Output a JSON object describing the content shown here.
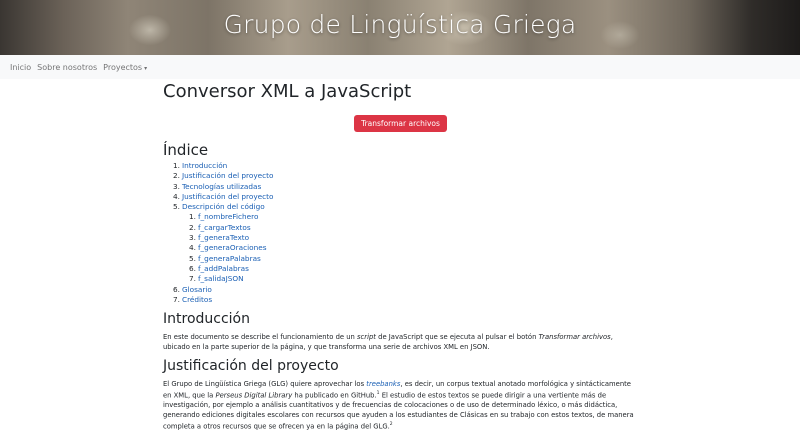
{
  "header": {
    "title": "Grupo de Lingüística Griega"
  },
  "nav": {
    "items": [
      {
        "label": "Inicio"
      },
      {
        "label": "Sobre nosotros"
      },
      {
        "label": "Proyectos",
        "caret": "▾"
      }
    ]
  },
  "main": {
    "title": "Conversor XML a JavaScript",
    "button_label": "Transformar archivos",
    "toc_heading": "Índice",
    "toc": [
      {
        "num": "1.",
        "label": "Introducción"
      },
      {
        "num": "2.",
        "label": "Justificación del proyecto"
      },
      {
        "num": "3.",
        "label": "Tecnologías utilizadas"
      },
      {
        "num": "4.",
        "label": "Justificación del proyecto"
      },
      {
        "num": "5.",
        "label": "Descripción del código",
        "children": [
          {
            "num": "1.",
            "label": "f_nombreFichero"
          },
          {
            "num": "2.",
            "label": "f_cargarTextos"
          },
          {
            "num": "3.",
            "label": "f_generaTexto"
          },
          {
            "num": "4.",
            "label": "f_generaOraciones"
          },
          {
            "num": "5.",
            "label": "f_generaPalabras"
          },
          {
            "num": "6.",
            "label": "f_addPalabras"
          },
          {
            "num": "7.",
            "label": "f_salidaJSON"
          }
        ]
      },
      {
        "num": "6.",
        "label": "Glosario"
      },
      {
        "num": "7.",
        "label": "Créditos"
      }
    ],
    "intro": {
      "heading": "Introducción",
      "p1_a": "En este documento se describe el funcionamiento de un ",
      "p1_script": "script",
      "p1_b": " de JavaScript que se ejecuta al pulsar el botón ",
      "p1_transform": "Transformar archivos",
      "p1_c": ", ubicado en la parte superior de la página, y que transforma una serie de archivos XML en JSON."
    },
    "justificacion": {
      "heading": "Justificación del proyecto",
      "p_a": "El Grupo de Lingüística Griega (GLG) quiere aprovechar los ",
      "p_treebanks": "treebanks",
      "p_b": ", es decir, un corpus textual anotado morfológica y sintácticamente en XML, que la ",
      "p_perseus": "Perseus Digital Library",
      "p_c": " ha publicado en GitHub.",
      "p_sup1": "1",
      "p_d": " El estudio de estos textos se puede dirigir a una vertiente más de investigación, por ejemplo a análisis cuantitativos y de frecuencias de colocaciones o de uso de determinado léxico, o más didáctica, generando ediciones digitales escolares con recursos que ayuden a los estudiantes de Clásicas en su trabajo con estos textos, de manera completa a otros recursos que se ofrecen ya en la página del GLG.",
      "p_sup2": "2"
    }
  },
  "colors": {
    "accent": "#dc3545",
    "link": "#1a5fb4",
    "navbar_bg": "#f8f9fa"
  }
}
